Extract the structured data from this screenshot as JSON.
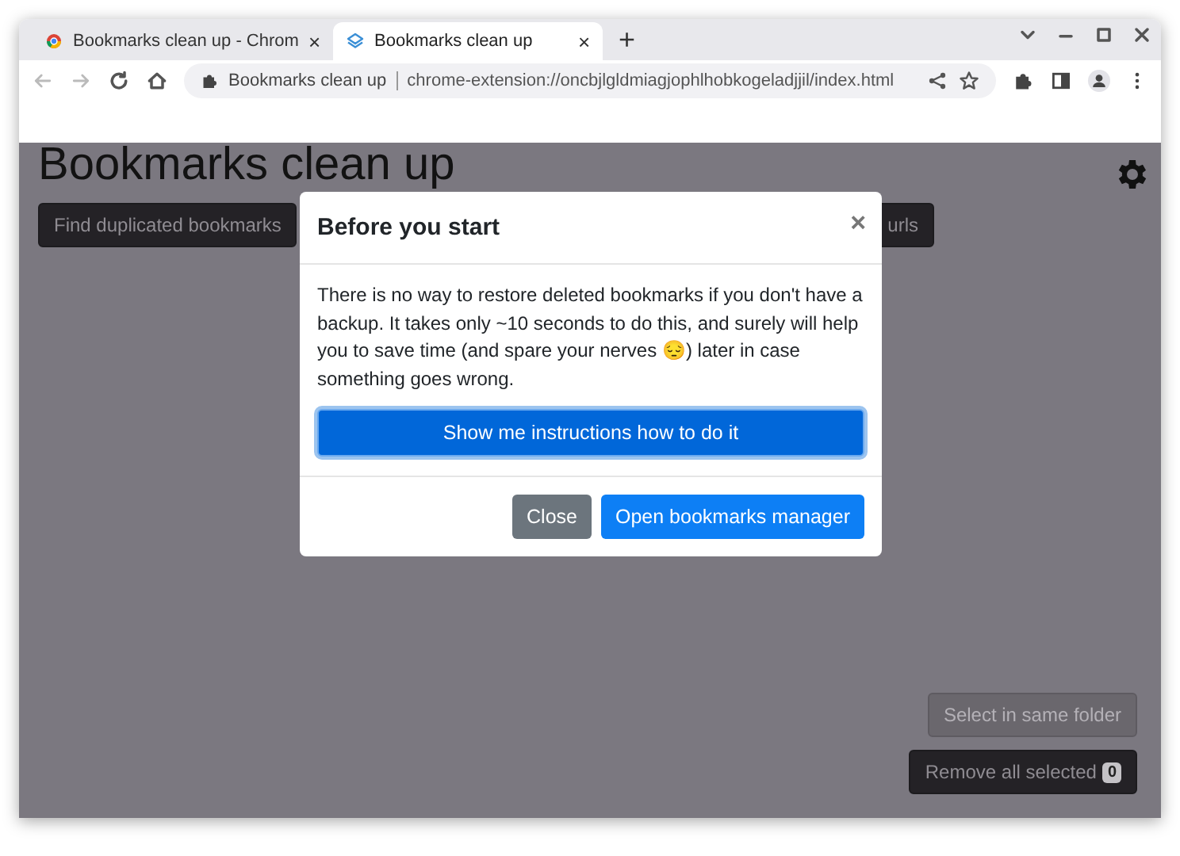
{
  "browser": {
    "tabs": [
      {
        "title": "Bookmarks clean up - Chrom",
        "selected": false,
        "close": "×"
      },
      {
        "title": "Bookmarks clean up",
        "selected": true,
        "close": "×"
      }
    ],
    "new_tab": "+",
    "address": {
      "site": "Bookmarks clean up",
      "url": "chrome-extension://oncbjlgldmiagjophlhobkogeladjjil/index.html"
    }
  },
  "page": {
    "title": "Bookmarks clean up",
    "toolbar_buttons": [
      {
        "label": "Find duplicated bookmarks"
      },
      {
        "label": "urls"
      }
    ],
    "side_buttons": [
      {
        "label": "Select in same folder",
        "disabled": true
      },
      {
        "label": "Remove all selected",
        "disabled": false,
        "badge": "0"
      }
    ]
  },
  "dialog": {
    "title": "Before you start",
    "close": "×",
    "message": "There is no way to restore deleted bookmarks if you don't have a backup. It takes only ~10 seconds to do this, and surely will help you to save time (and spare your nerves 😔) later in case something goes wrong.",
    "primary_action": "Show me instructions how to do it",
    "buttons": [
      {
        "label": "Close",
        "kind": "secondary"
      },
      {
        "label": "Open bookmarks manager",
        "kind": "primary"
      }
    ]
  }
}
